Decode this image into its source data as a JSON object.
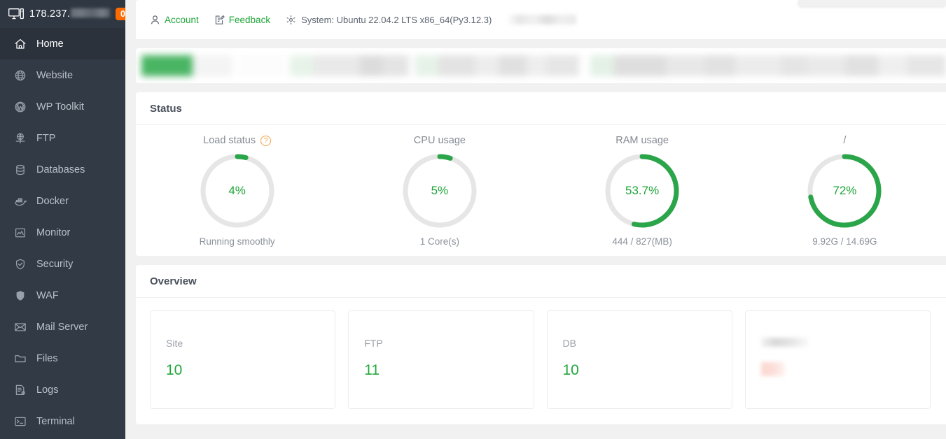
{
  "sidebar": {
    "host": "178.237.",
    "host_redacted": true,
    "badge": "0",
    "items": [
      {
        "label": "Home",
        "icon": "home-icon",
        "active": true
      },
      {
        "label": "Website",
        "icon": "globe-icon",
        "active": false
      },
      {
        "label": "WP Toolkit",
        "icon": "wordpress-icon",
        "active": false
      },
      {
        "label": "FTP",
        "icon": "ftp-icon",
        "active": false
      },
      {
        "label": "Databases",
        "icon": "database-icon",
        "active": false
      },
      {
        "label": "Docker",
        "icon": "docker-icon",
        "active": false
      },
      {
        "label": "Monitor",
        "icon": "monitor-chart-icon",
        "active": false
      },
      {
        "label": "Security",
        "icon": "shield-check-icon",
        "active": false
      },
      {
        "label": "WAF",
        "icon": "shield-icon",
        "active": false
      },
      {
        "label": "Mail Server",
        "icon": "mail-icon",
        "active": false
      },
      {
        "label": "Files",
        "icon": "folder-icon",
        "active": false
      },
      {
        "label": "Logs",
        "icon": "logs-icon",
        "active": false
      },
      {
        "label": "Terminal",
        "icon": "terminal-icon",
        "active": false
      }
    ]
  },
  "topbar": {
    "account_label": "Account",
    "feedback_label": "Feedback",
    "system_label": "System: Ubuntu 22.04.2 LTS x86_64(Py3.12.3)"
  },
  "status": {
    "title": "Status",
    "gauges": [
      {
        "title": "Load status",
        "has_help": true,
        "value": "4%",
        "percent": 4,
        "sub": "Running smoothly"
      },
      {
        "title": "CPU usage",
        "has_help": false,
        "value": "5%",
        "percent": 5,
        "sub": "1 Core(s)"
      },
      {
        "title": "RAM usage",
        "has_help": false,
        "value": "53.7%",
        "percent": 53.7,
        "sub": "444 / 827(MB)"
      },
      {
        "title": "/",
        "has_help": false,
        "value": "72%",
        "percent": 72,
        "sub": "9.92G / 14.69G"
      }
    ]
  },
  "overview": {
    "title": "Overview",
    "cards": [
      {
        "label": "Site",
        "value": "10",
        "redacted": false
      },
      {
        "label": "FTP",
        "value": "11",
        "redacted": false
      },
      {
        "label": "DB",
        "value": "10",
        "redacted": false
      },
      {
        "label": "",
        "value": "",
        "redacted": true
      }
    ]
  },
  "colors": {
    "accent_green": "#20a53a",
    "ring_green": "#2ba54a",
    "ring_track": "#e6e6e6",
    "badge_orange": "#ff6a00",
    "sidebar_bg": "#323a45",
    "help_orange": "#f0a040"
  }
}
